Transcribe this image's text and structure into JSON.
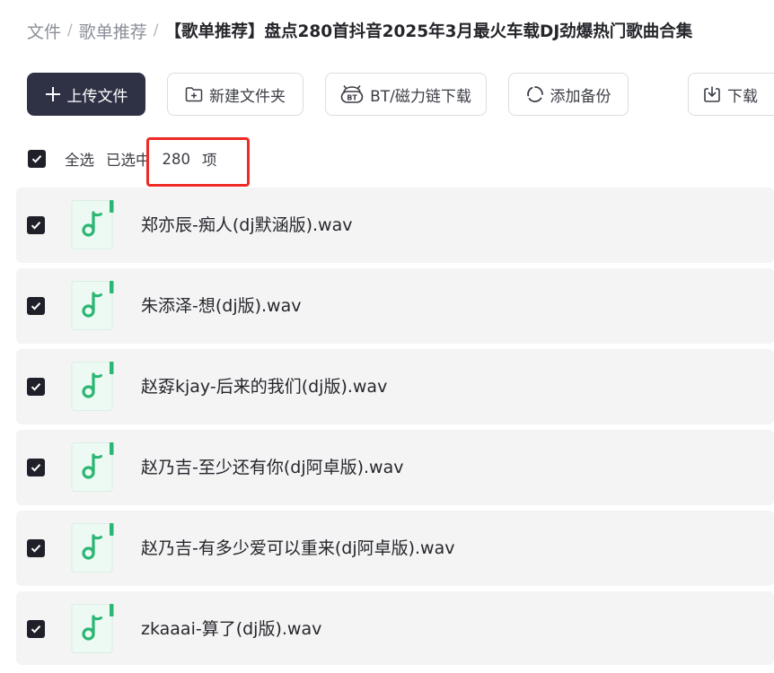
{
  "breadcrumb": {
    "items": [
      "文件",
      "歌单推荐"
    ],
    "separator": "/",
    "current": "【歌单推荐】盘点280首抖音2025年3月最火车载DJ劲爆热门歌曲合集"
  },
  "toolbar": {
    "upload_label": "上传文件",
    "new_folder_label": "新建文件夹",
    "bt_download_label": "BT/磁力链下载",
    "add_backup_label": "添加备份",
    "download_label": "下载"
  },
  "selection": {
    "select_all_label": "全选",
    "selected_prefix": "已选中",
    "selected_count": "280",
    "selected_suffix": "项"
  },
  "files": [
    {
      "name": "郑亦辰-痴人(dj默涵版).wav"
    },
    {
      "name": "朱添泽-想(dj版).wav"
    },
    {
      "name": "赵孬kjay-后来的我们(dj版).wav"
    },
    {
      "name": "赵乃吉-至少还有你(dj阿卓版).wav"
    },
    {
      "name": "赵乃吉-有多少爱可以重来(dj阿卓版).wav"
    },
    {
      "name": "zkaaai-算了(dj版).wav"
    }
  ],
  "colors": {
    "primary_button": "#2f3245",
    "audio_icon_green": "#2bb673",
    "highlight_red": "#ee2a24"
  }
}
